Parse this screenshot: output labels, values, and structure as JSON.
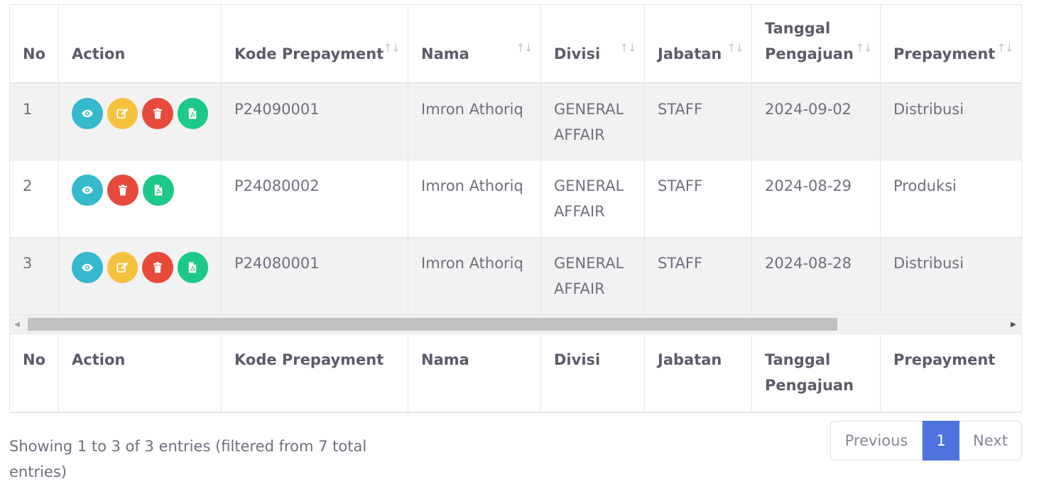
{
  "columns": [
    {
      "label": "No",
      "sortable": false
    },
    {
      "label": "Action",
      "sortable": false
    },
    {
      "label": "Kode Prepayment",
      "sortable": true
    },
    {
      "label": "Nama",
      "sortable": true
    },
    {
      "label": "Divisi",
      "sortable": true
    },
    {
      "label": "Jabatan",
      "sortable": true
    },
    {
      "label": "Tanggal Pengajuan",
      "sortable": true
    },
    {
      "label": "Prepayment",
      "sortable": true
    }
  ],
  "sort_icon": "↑↓",
  "rows": [
    {
      "no": "1",
      "actions": [
        "view",
        "edit",
        "delete",
        "pdf"
      ],
      "kode": "P24090001",
      "nama": "Imron Athoriq",
      "divisi": "GENERAL AFFAIR",
      "jabatan": "STAFF",
      "tanggal": "2024-09-02",
      "prepayment": "Distribusi"
    },
    {
      "no": "2",
      "actions": [
        "view",
        "delete",
        "pdf"
      ],
      "kode": "P24080002",
      "nama": "Imron Athoriq",
      "divisi": "GENERAL AFFAIR",
      "jabatan": "STAFF",
      "tanggal": "2024-08-29",
      "prepayment": "Produksi"
    },
    {
      "no": "3",
      "actions": [
        "view",
        "edit",
        "delete",
        "pdf"
      ],
      "kode": "P24080001",
      "nama": "Imron Athoriq",
      "divisi": "GENERAL AFFAIR",
      "jabatan": "STAFF",
      "tanggal": "2024-08-28",
      "prepayment": "Distribusi"
    }
  ],
  "action_buttons": {
    "view": {
      "icon": "eye-icon",
      "color": "#36b9cc"
    },
    "edit": {
      "icon": "edit-icon",
      "color": "#f6c23e"
    },
    "delete": {
      "icon": "trash-icon",
      "color": "#e74a3b"
    },
    "pdf": {
      "icon": "file-pdf-icon",
      "color": "#1cc88a"
    }
  },
  "info": {
    "text": "Showing 1 to 3 of 3 entries (filtered from 7 total entries)"
  },
  "pagination": {
    "previous": "Previous",
    "current": "1",
    "next": "Next",
    "active_color": "#4e73df"
  }
}
